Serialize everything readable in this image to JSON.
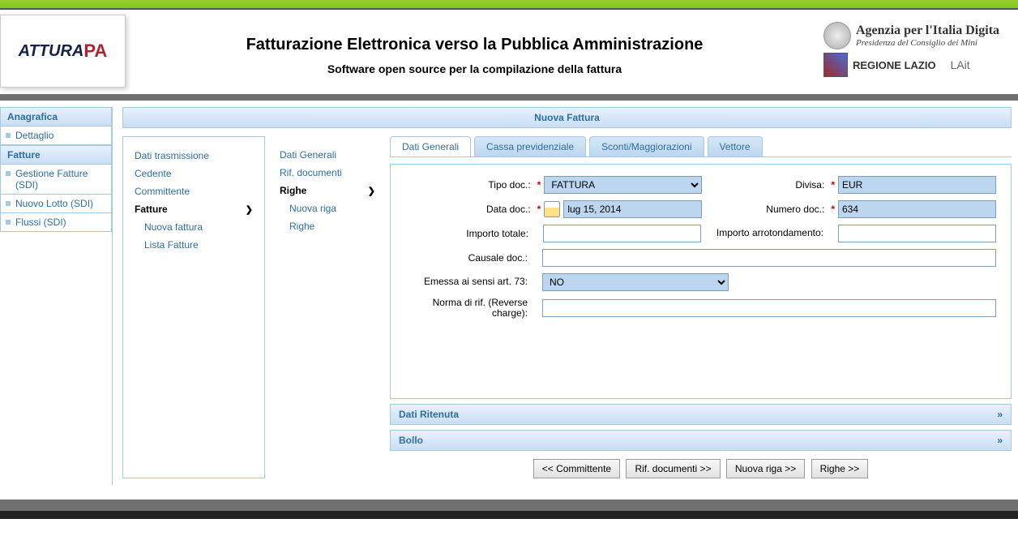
{
  "header": {
    "logo_text": "ATTURA",
    "logo_suffix": "PA",
    "title": "Fatturazione Elettronica verso la Pubblica Amministrazione",
    "subtitle": "Software open source per la compilazione della fattura",
    "agency_line1": "Agenzia per l'Italia Digita",
    "agency_line2": "Presidenza del Consiglio dei Mini",
    "region_text": "REGIONE LAZIO",
    "lait_text": "LAit"
  },
  "sidebar": {
    "sec1": "Anagrafica",
    "items1": [
      "Dettaglio"
    ],
    "sec2": "Fatture",
    "items2": [
      "Gestione Fatture (SDI)",
      "Nuovo Lotto (SDI)",
      "Flussi (SDI)"
    ]
  },
  "content": {
    "title": "Nuova Fattura",
    "nav1": [
      "Dati trasmissione",
      "Cedente",
      "Committente"
    ],
    "nav1_active": "Fatture",
    "nav1_sub": [
      "Nuova fattura",
      "Lista Fatture"
    ],
    "nav2": [
      "Dati Generali",
      "Rif. documenti"
    ],
    "nav2_active": "Righe",
    "nav2_sub": [
      "Nuova riga",
      "Righe"
    ],
    "tabs": [
      "Dati Generali",
      "Cassa previdenziale",
      "Sconti/Maggiorazioni",
      "Vettore"
    ],
    "labels": {
      "tipo_doc": "Tipo doc.:",
      "divisa": "Divisa:",
      "data_doc": "Data doc.:",
      "numero_doc": "Numero doc.:",
      "importo_totale": "Importo totale:",
      "importo_arr": "Importo arrotondamento:",
      "causale": "Causale doc.:",
      "emessa": "Emessa ai sensi art. 73:",
      "norma": "Norma di rif. (Reverse charge):"
    },
    "values": {
      "tipo_doc": "FATTURA",
      "divisa": "EUR",
      "data_doc": "lug 15, 2014",
      "numero_doc": "634",
      "importo_totale": "",
      "importo_arr": "",
      "causale": "",
      "emessa": "NO",
      "norma": ""
    },
    "accordions": [
      "Dati Ritenuta",
      "Bollo"
    ],
    "accordion_chev": "»",
    "buttons": [
      "<< Committente",
      "Rif. documenti >>",
      "Nuova riga >>",
      "Righe >>"
    ]
  }
}
